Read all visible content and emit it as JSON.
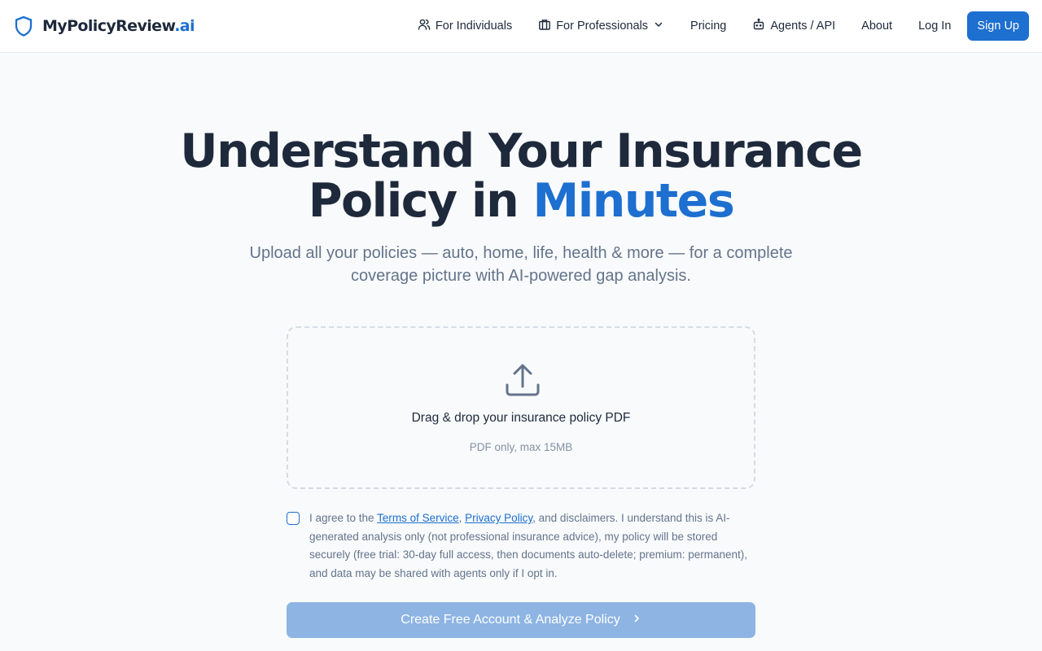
{
  "brand": {
    "name_main": "MyPolicyReview",
    "name_suffix": ".ai",
    "icon": "shield-icon",
    "color": "#1d6fd0"
  },
  "nav": {
    "items": [
      {
        "label": "For Individuals",
        "icon": "users-icon"
      },
      {
        "label": "For Professionals",
        "icon": "briefcase-icon",
        "dropdown": true
      },
      {
        "label": "Pricing"
      },
      {
        "label": "Agents / API",
        "icon": "bot-icon"
      },
      {
        "label": "About"
      },
      {
        "label": "Log In"
      }
    ],
    "signup_label": "Sign Up"
  },
  "hero": {
    "title_line1": "Understand Your Insurance",
    "title_line2_prefix": "Policy in ",
    "title_line2_accent": "Minutes",
    "subtitle": "Upload all your policies — auto, home, life, health & more — for a complete coverage picture with AI-powered gap analysis."
  },
  "upload": {
    "icon": "upload-icon",
    "title": "Drag & drop your insurance policy PDF",
    "hint": "PDF only, max 15MB"
  },
  "consent": {
    "checked": false,
    "prefix": "I agree to the ",
    "terms_link": "Terms of Service",
    "separator": ", ",
    "privacy_link": "Privacy Policy",
    "suffix": ", and disclaimers. I understand this is AI-generated analysis only (not professional insurance advice), my policy will be stored securely (free trial: 30-day full access, then documents auto-delete; premium: permanent), and data may be shared with agents only if I opt in."
  },
  "cta": {
    "label": "Create Free Account & Analyze Policy",
    "icon": "chevron-right-icon",
    "disabled": true
  },
  "colors": {
    "accent": "#1d6fd0",
    "text": "#1e293b",
    "muted": "#64748b",
    "background": "#f8fafc",
    "cta_disabled": "#8db4e3"
  }
}
